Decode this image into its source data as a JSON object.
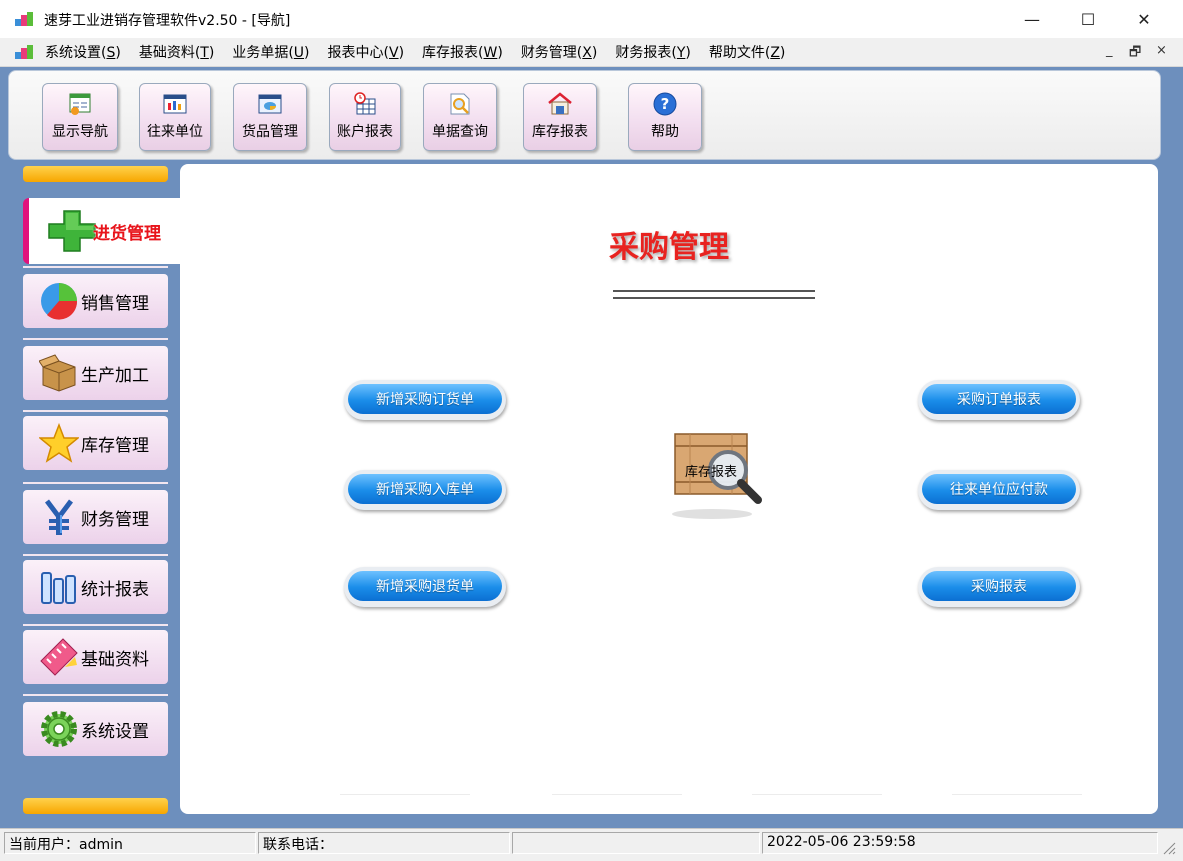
{
  "window": {
    "title": "速芽工业进销存管理软件v2.50 - [导航]",
    "controls": {
      "minimize": "—",
      "maximize": "☐",
      "close": "✕"
    }
  },
  "menubar": {
    "items": [
      {
        "label": "系统设置(",
        "key": "S",
        "tail": ")"
      },
      {
        "label": "基础资料(",
        "key": "T",
        "tail": ")"
      },
      {
        "label": "业务单据(",
        "key": "U",
        "tail": ")"
      },
      {
        "label": "报表中心(",
        "key": "V",
        "tail": ")"
      },
      {
        "label": "库存报表(",
        "key": "W",
        "tail": ")"
      },
      {
        "label": "财务管理(",
        "key": "X",
        "tail": ")"
      },
      {
        "label": "财务报表(",
        "key": "Y",
        "tail": ")"
      },
      {
        "label": "帮助文件(",
        "key": "Z",
        "tail": ")"
      }
    ],
    "mdi_controls": {
      "minimize": "_",
      "restore": "🗗",
      "close": "×"
    }
  },
  "toolbar": {
    "buttons": [
      {
        "label": "显示导航",
        "icon": "navigation-icon"
      },
      {
        "label": "往来单位",
        "icon": "partner-icon"
      },
      {
        "label": "货品管理",
        "icon": "goods-icon"
      },
      {
        "label": "账户报表",
        "icon": "account-report-icon"
      },
      {
        "label": "单据查询",
        "icon": "document-search-icon"
      },
      {
        "label": "库存报表",
        "icon": "warehouse-icon"
      },
      {
        "label": "帮助",
        "icon": "help-icon"
      }
    ]
  },
  "leftnav": {
    "active": {
      "label": "进货管理",
      "icon": "plus-icon"
    },
    "items": [
      {
        "label": "销售管理",
        "icon": "pie-icon"
      },
      {
        "label": "生产加工",
        "icon": "box-icon"
      },
      {
        "label": "库存管理",
        "icon": "star-icon"
      },
      {
        "label": "财务管理",
        "icon": "yen-icon"
      },
      {
        "label": "统计报表",
        "icon": "bars-icon"
      },
      {
        "label": "基础资料",
        "icon": "ruler-icon"
      },
      {
        "label": "系统设置",
        "icon": "gear-icon"
      }
    ]
  },
  "main": {
    "title": "采购管理",
    "left_buttons": [
      "新增采购订货单",
      "新增采购入库单",
      "新增采购退货单"
    ],
    "right_buttons": [
      "采购订单报表",
      "往来单位应付款",
      "采购报表"
    ],
    "center": {
      "label": "库存报表",
      "icon": "inventory-search-icon"
    }
  },
  "statusbar": {
    "user": "当前用户：admin",
    "phone": "联系电话：",
    "blank": "",
    "datetime": "2022-05-06 23:59:58"
  },
  "colors": {
    "frame": "#6d8fbd",
    "accent_red": "#e82320",
    "active_marker": "#e0127c",
    "pill_blue": "#1a8de9",
    "orange_bar": "#f7a600"
  }
}
